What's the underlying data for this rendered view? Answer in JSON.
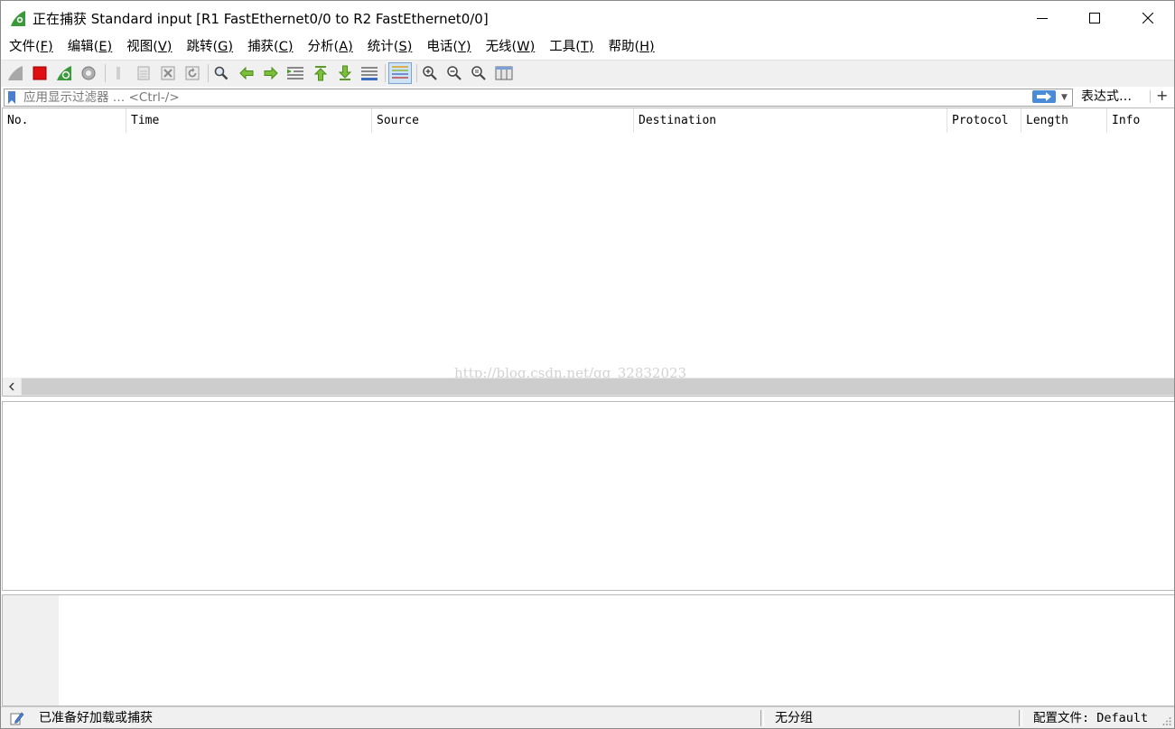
{
  "window": {
    "title": "正在捕获 Standard input [R1 FastEthernet0/0 to R2 FastEthernet0/0]",
    "accent_color": "#3a9a3a"
  },
  "menu": [
    {
      "label": "文件(",
      "key": "F",
      "suffix": ")"
    },
    {
      "label": "编辑(",
      "key": "E",
      "suffix": ")"
    },
    {
      "label": "视图(",
      "key": "V",
      "suffix": ")"
    },
    {
      "label": "跳转(",
      "key": "G",
      "suffix": ")"
    },
    {
      "label": "捕获(",
      "key": "C",
      "suffix": ")"
    },
    {
      "label": "分析(",
      "key": "A",
      "suffix": ")"
    },
    {
      "label": "统计(",
      "key": "S",
      "suffix": ")"
    },
    {
      "label": "电话(",
      "key": "Y",
      "suffix": ")"
    },
    {
      "label": "无线(",
      "key": "W",
      "suffix": ")"
    },
    {
      "label": "工具(",
      "key": "T",
      "suffix": ")"
    },
    {
      "label": "帮助(",
      "key": "H",
      "suffix": ")"
    }
  ],
  "toolbar": {
    "icons": [
      "shark-fin-start-icon",
      "stop-capture-icon",
      "restart-capture-icon",
      "capture-options-icon",
      "open-file-icon",
      "save-file-icon",
      "close-file-icon",
      "reload-file-icon",
      "find-packet-icon",
      "go-back-icon",
      "go-forward-icon",
      "go-to-packet-icon",
      "go-first-packet-icon",
      "go-last-packet-icon",
      "autoscroll-icon",
      "colorize-icon",
      "zoom-in-icon",
      "zoom-out-icon",
      "zoom-normal-icon",
      "resize-columns-icon"
    ]
  },
  "filter": {
    "placeholder": "应用显示过滤器 … <Ctrl-/>",
    "expression_label": "表达式…",
    "add_label": "+"
  },
  "packet_list": {
    "columns": [
      "No.",
      "Time",
      "Source",
      "Destination",
      "Protocol",
      "Length",
      "Info"
    ],
    "watermark": "http://blog.csdn.net/qq_32832023"
  },
  "status": {
    "ready": "已准备好加载或捕获",
    "packets": "无分组",
    "profile": "配置文件: Default"
  }
}
